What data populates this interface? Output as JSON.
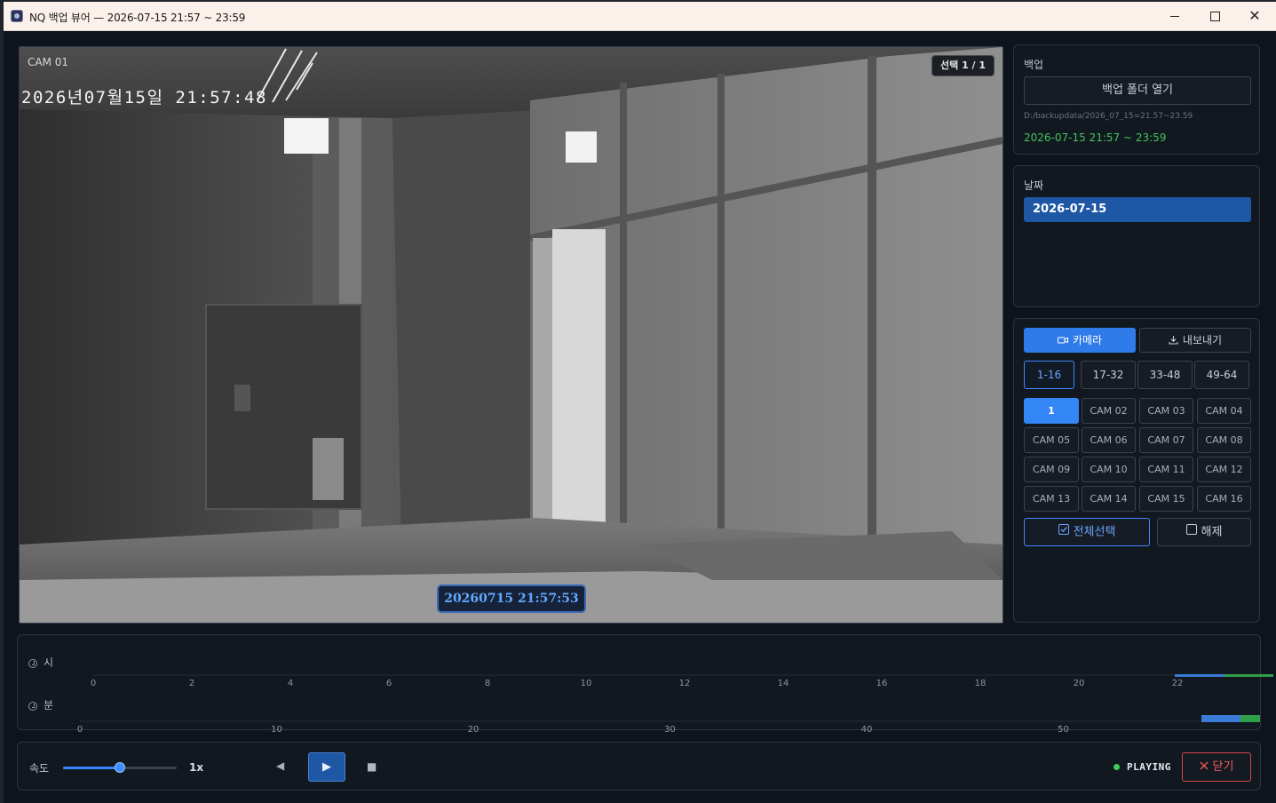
{
  "window": {
    "title": "NQ 백업 뷰어 — 2026-07-15  21:57 ~ 23:59",
    "min_icon": "minimize-icon",
    "max_icon": "maximize-icon",
    "close_glyph": "✕"
  },
  "video": {
    "cam_label": "CAM 01",
    "osd_time": "2026년07월15일  21:57:48",
    "selection_badge": "선택 1 / 1",
    "timestamp": "20260715 21:57:53"
  },
  "backup_panel": {
    "title": "백업",
    "open_button": "백업 폴더 열기",
    "path": "D:/backupdata/2026_07_15=21.57~23.59",
    "range": "2026-07-15  21:57 ~ 23:59",
    "range_color": "#41c55c"
  },
  "date_panel": {
    "title": "날짜",
    "dates": [
      "2026-07-15"
    ],
    "selected_index": 0
  },
  "camera_panel": {
    "tabs": [
      {
        "label": "카메라",
        "icon": "camera-icon",
        "active": true
      },
      {
        "label": "내보내기",
        "icon": "download-icon",
        "active": false
      }
    ],
    "ranges": [
      "1-16",
      "17-32",
      "33-48",
      "49-64"
    ],
    "active_range": 0,
    "cams": [
      "1",
      "CAM 02",
      "CAM 03",
      "CAM 04",
      "CAM 05",
      "CAM 06",
      "CAM 07",
      "CAM 08",
      "CAM 09",
      "CAM 10",
      "CAM 11",
      "CAM 12",
      "CAM 13",
      "CAM 14",
      "CAM 15",
      "CAM 16"
    ],
    "active_cam": 0,
    "select_all": "전체선택",
    "deselect": "해제",
    "accent": "#3485f5"
  },
  "timeline": {
    "hour_label": "시",
    "minute_label": "분",
    "hour_ticks": [
      "0",
      "2",
      "4",
      "6",
      "8",
      "10",
      "12",
      "14",
      "16",
      "18",
      "20",
      "22"
    ],
    "hour_tick_values": [
      0,
      2,
      4,
      6,
      8,
      10,
      12,
      14,
      16,
      18,
      20,
      22
    ],
    "hour_max": 24,
    "minute_ticks": [
      "0",
      "10",
      "20",
      "30",
      "40",
      "50"
    ],
    "minute_tick_values": [
      0,
      10,
      20,
      30,
      40,
      50
    ],
    "minute_max": 60,
    "hour_segments": [
      {
        "start": 21.95,
        "end": 22.95,
        "color": "#3a7bd5"
      },
      {
        "start": 22.95,
        "end": 23.95,
        "color": "#2f9e48"
      }
    ],
    "minute_segments": [
      {
        "start": 57,
        "end": 59,
        "color": "#3a7bd5"
      },
      {
        "start": 59,
        "end": 60,
        "color": "#2f9e48"
      }
    ]
  },
  "controls": {
    "speed_label": "속도",
    "speed_value": "1x",
    "speed_fraction": 0.5,
    "prev_glyph": "◀",
    "play_glyph": "▶",
    "stop_glyph": "■",
    "status": "PLAYING",
    "status_color": "#3ecf5a",
    "close_label": "닫기"
  }
}
